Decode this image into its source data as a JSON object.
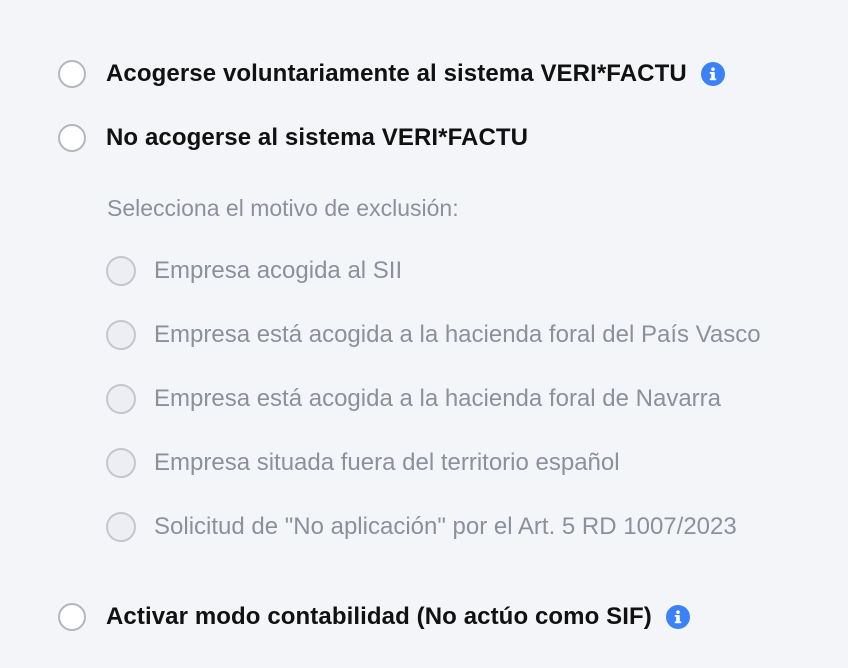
{
  "options": {
    "voluntary": {
      "label": "Acogerse voluntariamente al sistema VERI*FACTU",
      "info_icon": "info-icon",
      "selected": false
    },
    "not_join": {
      "label": "No acogerse al sistema VERI*FACTU",
      "selected": false
    },
    "accounting_mode": {
      "label": "Activar modo contabilidad (No actúo como SIF)",
      "info_icon": "info-icon",
      "selected": false
    }
  },
  "exclusion": {
    "title": "Selecciona el motivo de exclusión:",
    "reasons": [
      {
        "label": "Empresa acogida al SII",
        "selected": false
      },
      {
        "label": "Empresa está acogida a la hacienda foral del País Vasco",
        "selected": false
      },
      {
        "label": "Empresa está acogida a la hacienda foral de Navarra",
        "selected": false
      },
      {
        "label": "Empresa situada fuera del territorio español",
        "selected": false
      },
      {
        "label": "Solicitud de \"No aplicación\" por el Art. 5 RD 1007/2023",
        "selected": false
      }
    ]
  },
  "colors": {
    "background": "#f4f5f8",
    "info_icon": "#3b82f6",
    "muted_text": "#8b919c",
    "primary_text": "#111111"
  }
}
